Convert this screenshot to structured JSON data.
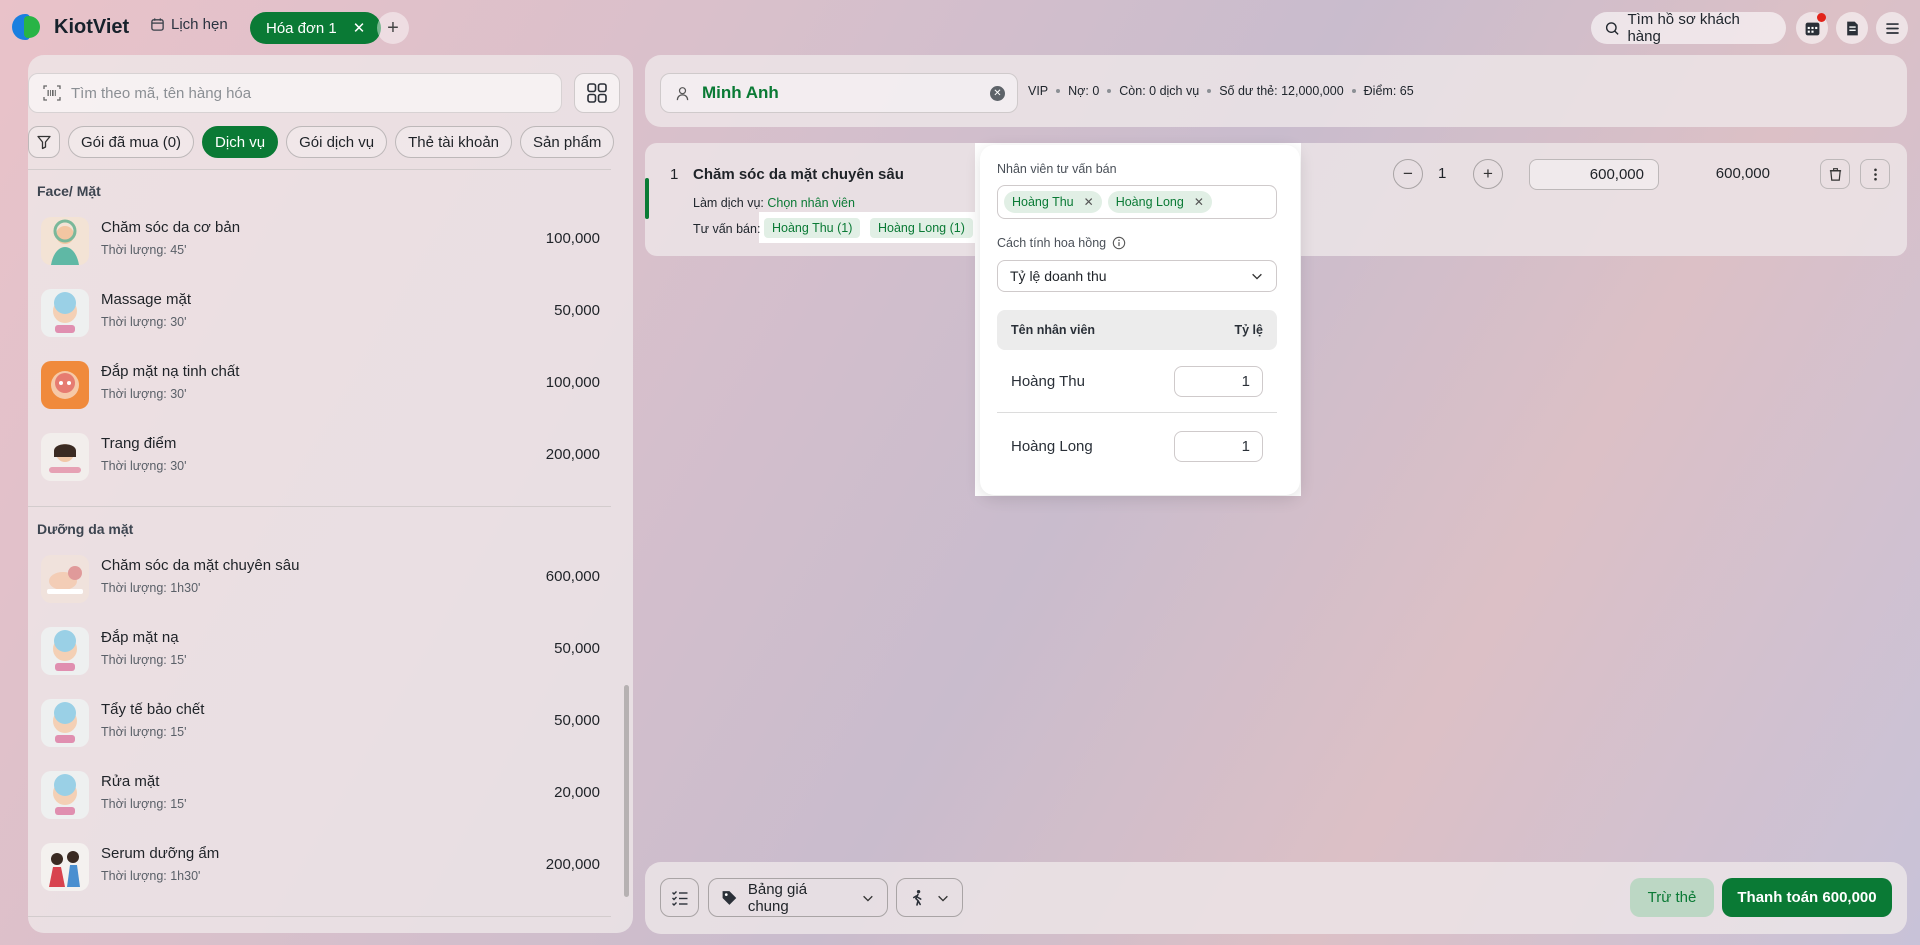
{
  "app": {
    "name": "KiotViet"
  },
  "topbar": {
    "appointments_label": "Lịch hẹn",
    "active_tab_label": "Hóa đơn 1",
    "customer_search_label": "Tìm hồ sơ khách hàng"
  },
  "left": {
    "search_placeholder": "Tìm theo mã, tên hàng hóa",
    "chips": [
      "Gói đã mua (0)",
      "Dịch vụ",
      "Gói dịch vụ",
      "Thẻ tài khoản",
      "Sản phẩm"
    ],
    "active_chip": "Dịch vụ",
    "sections": [
      {
        "title": "Face/ Mặt",
        "items": [
          {
            "name": "Chăm sóc da cơ bản",
            "duration": "Thời lượng: 45'",
            "price": "100,000"
          },
          {
            "name": "Massage mặt",
            "duration": "Thời lượng: 30'",
            "price": "50,000"
          },
          {
            "name": "Đắp mặt nạ tinh chất",
            "duration": "Thời lượng: 30'",
            "price": "100,000"
          },
          {
            "name": "Trang điểm",
            "duration": "Thời lượng: 30'",
            "price": "200,000"
          }
        ]
      },
      {
        "title": "Dưỡng da mặt",
        "items": [
          {
            "name": "Chăm sóc da mặt chuyên sâu",
            "duration": "Thời lượng: 1h30'",
            "price": "600,000"
          },
          {
            "name": "Đắp mặt nạ",
            "duration": "Thời lượng: 15'",
            "price": "50,000"
          },
          {
            "name": "Tẩy tế bảo chết",
            "duration": "Thời lượng: 15'",
            "price": "50,000"
          },
          {
            "name": "Rửa mặt",
            "duration": "Thời lượng: 15'",
            "price": "20,000"
          },
          {
            "name": "Serum dưỡng ẩm",
            "duration": "Thời lượng: 1h30'",
            "price": "200,000"
          }
        ]
      }
    ]
  },
  "customer": {
    "name": "Minh Anh",
    "tier": "VIP",
    "debt": "Nợ: 0",
    "remaining": "Còn: 0 dịch vụ",
    "card_balance": "Số dư thẻ: 12,000,000",
    "points": "Điểm: 65"
  },
  "order": {
    "index": "1",
    "service_name": "Chăm sóc da mặt chuyên sâu",
    "perform_label": "Làm dịch vụ:",
    "perform_link": "Chọn nhân viên",
    "advise_label": "Tư vấn bán:",
    "advisors": [
      "Hoàng Thu (1)",
      "Hoàng Long (1)"
    ],
    "qty_minus": "−",
    "quantity": "1",
    "qty_plus": "+",
    "unit_price": "600,000",
    "line_total": "600,000"
  },
  "popup": {
    "staff_label": "Nhân viên tư vấn bán",
    "tags": [
      "Hoàng Thu",
      "Hoàng Long"
    ],
    "commission_label": "Cách tính hoa hồng",
    "commission_method": "Tỷ lệ doanh thu",
    "col_staff": "Tên nhân viên",
    "col_ratio": "Tỷ lệ",
    "rows": [
      {
        "name": "Hoàng Thu",
        "ratio": "1"
      },
      {
        "name": "Hoàng Long",
        "ratio": "1"
      }
    ]
  },
  "bottom": {
    "price_list": "Bảng giá chung",
    "card_deduct": "Trừ thẻ",
    "pay_label": "Thanh toán 600,000"
  },
  "colors": {
    "brand_green": "#0a7a35",
    "accent_blue": "#1a7fe0",
    "notification": "#e2231a"
  },
  "icons": [
    "calendar-icon",
    "close-icon",
    "plus-icon",
    "search-icon",
    "calendar-grid-icon",
    "invoice-icon",
    "menu-icon",
    "barcode-scan-icon",
    "grid-view-icon",
    "filter-icon",
    "user-icon",
    "clear-icon",
    "trash-icon",
    "more-vertical-icon",
    "info-icon",
    "chevron-down-icon",
    "checklist-icon",
    "price-tag-icon",
    "walk-icon"
  ]
}
